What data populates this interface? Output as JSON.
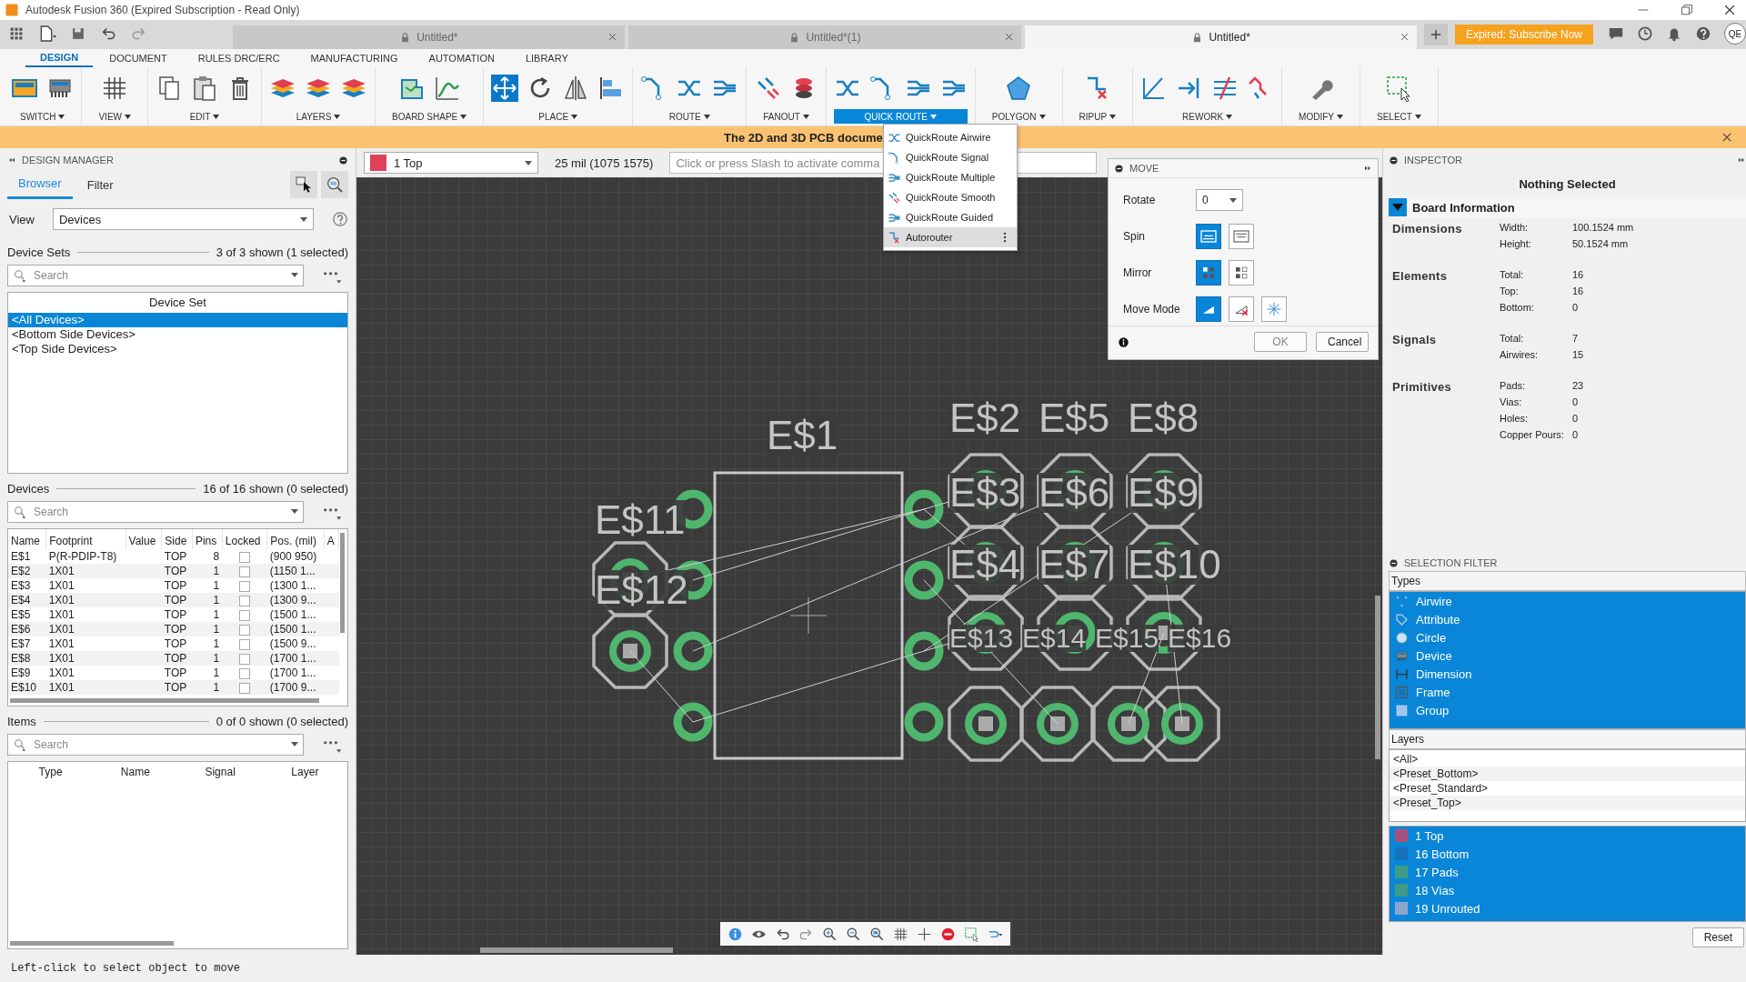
{
  "window": {
    "title": "Autodesk Fusion 360 (Expired Subscription - Read Only)"
  },
  "document_tabs": [
    {
      "label": "Untitled*",
      "selected": false
    },
    {
      "label": "Untitled*(1)",
      "selected": false
    },
    {
      "label": "Untitled*",
      "selected": true
    }
  ],
  "subscribe_button": "Expired: Subscribe Now",
  "user_initials": "QE",
  "ribbon_tabs": [
    {
      "label": "DESIGN",
      "selected": true
    },
    {
      "label": "DOCUMENT",
      "selected": false
    },
    {
      "label": "RULES DRC/ERC",
      "selected": false
    },
    {
      "label": "MANUFACTURING",
      "selected": false
    },
    {
      "label": "AUTOMATION",
      "selected": false
    },
    {
      "label": "LIBRARY",
      "selected": false
    }
  ],
  "tool_groups": [
    {
      "label": "SWITCH",
      "open": false
    },
    {
      "label": "VIEW",
      "open": false
    },
    {
      "label": "EDIT",
      "open": false
    },
    {
      "label": "LAYERS",
      "open": false
    },
    {
      "label": "BOARD SHAPE",
      "open": false
    },
    {
      "label": "PLACE",
      "open": false
    },
    {
      "label": "ROUTE",
      "open": false
    },
    {
      "label": "FANOUT",
      "open": false
    },
    {
      "label": "QUICK ROUTE",
      "open": true
    },
    {
      "label": "POLYGON",
      "open": false
    },
    {
      "label": "RIPUP",
      "open": false
    },
    {
      "label": "REWORK",
      "open": false
    },
    {
      "label": "MODIFY",
      "open": false
    },
    {
      "label": "SELECT",
      "open": false
    }
  ],
  "quick_route_menu": [
    {
      "label": "QuickRoute Airwire",
      "highlighted": false
    },
    {
      "label": "QuickRoute Signal",
      "highlighted": false
    },
    {
      "label": "QuickRoute Multiple",
      "highlighted": false
    },
    {
      "label": "QuickRoute Smooth",
      "highlighted": false
    },
    {
      "label": "QuickRoute Guided",
      "highlighted": false
    },
    {
      "label": "Autorouter",
      "highlighted": true
    }
  ],
  "banner": {
    "text": "The 2D and 3D PCB docume"
  },
  "design_manager": {
    "title": "DESIGN MANAGER",
    "tabs": [
      {
        "label": "Browser",
        "selected": true
      },
      {
        "label": "Filter",
        "selected": false
      }
    ],
    "view": {
      "label": "View",
      "value": "Devices"
    },
    "device_sets": {
      "heading": "Device Sets",
      "count": "3 of 3 shown (1 selected)",
      "search_placeholder": "Search",
      "column": "Device Set",
      "items": [
        {
          "label": "<All Devices>",
          "selected": true
        },
        {
          "label": "<Bottom Side Devices>",
          "selected": false
        },
        {
          "label": "<Top Side Devices>",
          "selected": false
        }
      ]
    },
    "devices": {
      "heading": "Devices",
      "count": "16 of 16 shown (0 selected)",
      "search_placeholder": "Search",
      "columns": [
        "Name",
        "Footprint",
        "Value",
        "Side",
        "Pins",
        "Locked",
        "Pos. (mil)",
        "A"
      ],
      "rows": [
        {
          "name": "E$1",
          "footprint": "P(R-PDIP-T8)",
          "side": "TOP",
          "pins": "8",
          "locked": false,
          "pos": "(900 950)"
        },
        {
          "name": "E$2",
          "footprint": "1X01",
          "side": "TOP",
          "pins": "1",
          "locked": false,
          "pos": "(1150 1..."
        },
        {
          "name": "E$3",
          "footprint": "1X01",
          "side": "TOP",
          "pins": "1",
          "locked": false,
          "pos": "(1300 1..."
        },
        {
          "name": "E$4",
          "footprint": "1X01",
          "side": "TOP",
          "pins": "1",
          "locked": false,
          "pos": "(1300 9..."
        },
        {
          "name": "E$5",
          "footprint": "1X01",
          "side": "TOP",
          "pins": "1",
          "locked": false,
          "pos": "(1500 1..."
        },
        {
          "name": "E$6",
          "footprint": "1X01",
          "side": "TOP",
          "pins": "1",
          "locked": false,
          "pos": "(1500 1..."
        },
        {
          "name": "E$7",
          "footprint": "1X01",
          "side": "TOP",
          "pins": "1",
          "locked": false,
          "pos": "(1500 9..."
        },
        {
          "name": "E$8",
          "footprint": "1X01",
          "side": "TOP",
          "pins": "1",
          "locked": false,
          "pos": "(1700 1..."
        },
        {
          "name": "E$9",
          "footprint": "1X01",
          "side": "TOP",
          "pins": "1",
          "locked": false,
          "pos": "(1700 1..."
        },
        {
          "name": "E$10",
          "footprint": "1X01",
          "side": "TOP",
          "pins": "1",
          "locked": false,
          "pos": "(1700 9..."
        }
      ]
    },
    "items": {
      "heading": "Items",
      "count": "0 of 0 shown (0 selected)",
      "search_placeholder": "Search",
      "columns": [
        "Type",
        "Name",
        "Signal",
        "Layer"
      ]
    }
  },
  "canvas_bar": {
    "layer": {
      "label": "1 Top",
      "color": "#e0405a"
    },
    "coordinates": "25 mil (1075 1575)",
    "command_placeholder": "Click or press Slash to activate comma"
  },
  "canvas": {
    "labels": [
      "E$1",
      "E$2",
      "E$5",
      "E$8",
      "E$3",
      "E$6",
      "E$9",
      "E$4",
      "E$7",
      "E$10",
      "E$11",
      "E$12",
      "E$13",
      "E$14",
      "E$15",
      "E$16"
    ]
  },
  "move_dialog": {
    "title": "MOVE",
    "rotate": {
      "label": "Rotate",
      "value": "0"
    },
    "options": [
      {
        "label": "Spin",
        "choices": [
          {
            "selected": true
          },
          {
            "selected": false
          }
        ]
      },
      {
        "label": "Mirror",
        "choices": [
          {
            "selected": true
          },
          {
            "selected": false
          }
        ]
      },
      {
        "label": "Move Mode",
        "choices": [
          {
            "selected": true
          },
          {
            "selected": false
          },
          {
            "selected": false
          }
        ]
      }
    ],
    "buttons": [
      {
        "label": "OK",
        "disabled": true
      },
      {
        "label": "Cancel",
        "disabled": false
      }
    ]
  },
  "inspector": {
    "title": "INSPECTOR",
    "subtitle": "Nothing Selected",
    "section": {
      "title": "Board Information",
      "expanded": true
    },
    "groups": [
      {
        "title": "Dimensions",
        "rows": [
          {
            "label": "Width:",
            "value": "100.1524 mm"
          },
          {
            "label": "Height:",
            "value": "50.1524 mm"
          }
        ]
      },
      {
        "title": "Elements",
        "rows": [
          {
            "label": "Total:",
            "value": "16"
          },
          {
            "label": "Top:",
            "value": "16"
          },
          {
            "label": "Bottom:",
            "value": "0"
          }
        ]
      },
      {
        "title": "Signals",
        "rows": [
          {
            "label": "Total:",
            "value": "7"
          },
          {
            "label": "Airwires:",
            "value": "15"
          }
        ]
      },
      {
        "title": "Primitives",
        "rows": [
          {
            "label": "Pads:",
            "value": "23"
          },
          {
            "label": "Vias:",
            "value": "0"
          },
          {
            "label": "Holes:",
            "value": "0"
          },
          {
            "label": "Copper Pours:",
            "value": "0"
          }
        ]
      }
    ]
  },
  "selection_filter": {
    "title": "SELECTION FILTER",
    "types_label": "Types",
    "types": [
      {
        "label": "Airwire",
        "selected": true
      },
      {
        "label": "Attribute",
        "selected": true
      },
      {
        "label": "Circle",
        "selected": true
      },
      {
        "label": "Device",
        "selected": true
      },
      {
        "label": "Dimension",
        "selected": true
      },
      {
        "label": "Frame",
        "selected": true
      },
      {
        "label": "Group",
        "selected": true
      }
    ],
    "layers_label": "Layers",
    "presets": [
      {
        "label": "<All>",
        "selected": false
      },
      {
        "label": "<Preset_Bottom>",
        "selected": false
      },
      {
        "label": "<Preset_Standard>",
        "selected": false
      },
      {
        "label": "<Preset_Top>",
        "selected": false
      }
    ],
    "layers": [
      {
        "label": "1 Top",
        "color": "#a8507e",
        "selected": true
      },
      {
        "label": "16 Bottom",
        "color": "#1673b8",
        "selected": true
      },
      {
        "label": "17 Pads",
        "color": "#3f9a86",
        "selected": true
      },
      {
        "label": "18 Vias",
        "color": "#3f9a86",
        "selected": true
      },
      {
        "label": "19 Unrouted",
        "color": "#8fa6cc",
        "selected": true
      }
    ],
    "reset_button": "Reset"
  },
  "status_bar": {
    "text": "Left-click to select object to move"
  }
}
